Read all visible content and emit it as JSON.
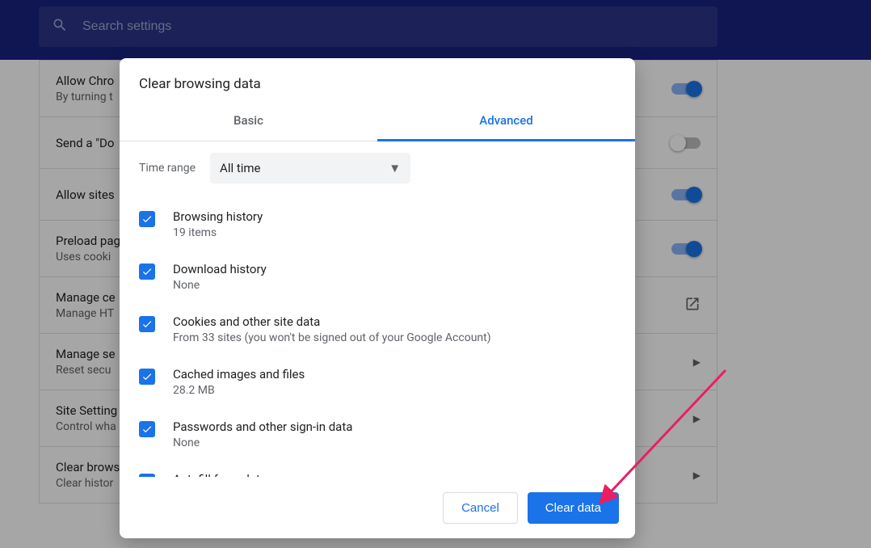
{
  "search": {
    "placeholder": "Search settings"
  },
  "settings": [
    {
      "title": "Allow Chro",
      "sub": "By turning t",
      "control": "toggle-on"
    },
    {
      "title": "Send a \"Do",
      "sub": "",
      "control": "toggle-off"
    },
    {
      "title": "Allow sites",
      "sub": "",
      "control": "toggle-on"
    },
    {
      "title": "Preload pag",
      "sub": "Uses cooki",
      "control": "toggle-on"
    },
    {
      "title": "Manage ce",
      "sub": "Manage HT",
      "control": "external"
    },
    {
      "title": "Manage se",
      "sub": "Reset secu",
      "control": "arrow"
    },
    {
      "title": "Site Setting",
      "sub": "Control wha",
      "control": "arrow"
    },
    {
      "title": "Clear brows",
      "sub": "Clear histor",
      "control": "arrow"
    }
  ],
  "dialog": {
    "title": "Clear browsing data",
    "tabs": {
      "basic": "Basic",
      "advanced": "Advanced",
      "active": "advanced"
    },
    "time_range": {
      "label": "Time range",
      "value": "All time"
    },
    "items": [
      {
        "title": "Browsing history",
        "sub": "19 items",
        "checked": true
      },
      {
        "title": "Download history",
        "sub": "None",
        "checked": true
      },
      {
        "title": "Cookies and other site data",
        "sub": "From 33 sites (you won't be signed out of your Google Account)",
        "checked": true
      },
      {
        "title": "Cached images and files",
        "sub": "28.2 MB",
        "checked": true
      },
      {
        "title": "Passwords and other sign-in data",
        "sub": "None",
        "checked": true
      },
      {
        "title": "Autofill form data",
        "sub": "",
        "checked": true
      }
    ],
    "buttons": {
      "cancel": "Cancel",
      "confirm": "Clear data"
    }
  },
  "annotation": {
    "arrow_color": "#e91e63"
  }
}
